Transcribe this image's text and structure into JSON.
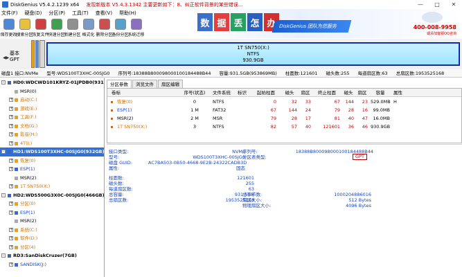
{
  "titlebar": {
    "title": "DiskGenius V5.4.2.1239 x64",
    "notice": "发现新版本 V5.4.3.1342  主要更新如下：8、纠正软件背景的某些错误..."
  },
  "menu": [
    "文件(F)",
    "硬盘(D)",
    "分区(P)",
    "工具(T)",
    "查看(V)",
    "帮助(H)"
  ],
  "toolbar": [
    "保存更改",
    "搜索分区",
    "恢复文件",
    "快速分区",
    "新建分区",
    "格式化",
    "删除分区",
    "备份分区",
    "系统迁移"
  ],
  "banner": {
    "tiles": [
      "数",
      "据",
      "丢",
      "怎",
      "办"
    ],
    "brand": "DiskGenius 团队为您服务",
    "phone": "400-008-9958",
    "qq": "或添加客服QQ咨询"
  },
  "diskmap": {
    "basic_line1": "基本",
    "basic_line2": "GPT",
    "seg_name": "1T SN750(X:)",
    "seg_fs": "NTFS",
    "seg_size": "930.9GB"
  },
  "diskinfo": {
    "iface": "磁盘1 接口:NVMe",
    "model": "型号:WDS100T3XHC-00SJG0",
    "serial": "序列号:18388B800098000100184488B44",
    "capacity": "容量:931.5GB(953869MB)",
    "cyl": "柱面数:121601",
    "heads": "磁头数:255",
    "spt": "每道扇区数:63",
    "total": "总扇区数:1953525168"
  },
  "tree": [
    {
      "level": 0,
      "toggle": "-",
      "text": "HD0:WDCWD101KRYZ-01JPDB0(931.5GB)",
      "color": ""
    },
    {
      "level": 1,
      "toggle": "",
      "text": "MSR(0)",
      "color": ""
    },
    {
      "level": 1,
      "toggle": "+",
      "text": "启动(C:)",
      "color": "orange"
    },
    {
      "level": 1,
      "toggle": "+",
      "text": "游戏(E:)",
      "color": "orange"
    },
    {
      "level": 1,
      "toggle": "+",
      "text": "工具(F:)",
      "color": "orange"
    },
    {
      "level": 1,
      "toggle": "+",
      "text": "文档(G:)",
      "color": "orange"
    },
    {
      "level": 1,
      "toggle": "+",
      "text": "影音(H:)",
      "color": "orange"
    },
    {
      "level": 1,
      "toggle": "+",
      "text": "4T(I:)",
      "color": "orange"
    },
    {
      "level": 0,
      "toggle": "-",
      "text": "HD1:WDS100T3XHC-00SJG0(932GB)",
      "color": "",
      "selected": true
    },
    {
      "level": 1,
      "toggle": "+",
      "text": "恢复(0)",
      "color": "orange"
    },
    {
      "level": 1,
      "toggle": "+",
      "text": "ESP(1)",
      "color": "blue"
    },
    {
      "level": 1,
      "toggle": "",
      "text": "MSR(2)",
      "color": ""
    },
    {
      "level": 1,
      "toggle": "+",
      "text": "1T SN750(X:)",
      "color": "orange"
    },
    {
      "level": 0,
      "toggle": "-",
      "text": "HD2:WDS500G3X0C-00SJG0(466GB)",
      "color": ""
    },
    {
      "level": 1,
      "toggle": "+",
      "text": "分区(0)",
      "color": "orange"
    },
    {
      "level": 1,
      "toggle": "+",
      "text": "ESP(1)",
      "color": "blue"
    },
    {
      "level": 1,
      "toggle": "",
      "text": "MSR(2)",
      "color": ""
    },
    {
      "level": 1,
      "toggle": "+",
      "text": "系统(C:)",
      "color": "orange"
    },
    {
      "level": 1,
      "toggle": "+",
      "text": "软件(D:)",
      "color": "orange"
    },
    {
      "level": 1,
      "toggle": "+",
      "text": "分区(4)",
      "color": "orange"
    },
    {
      "level": 0,
      "toggle": "-",
      "text": "RD3:SanDiskCruzer(7GB)",
      "color": ""
    },
    {
      "level": 1,
      "toggle": "+",
      "text": "SANDISK(J:)",
      "color": "blue"
    }
  ],
  "tabs": [
    "分区参数",
    "浏览文件",
    "扇区编辑"
  ],
  "ptable": {
    "headers": [
      "卷标",
      "序号(状态)",
      "文件系统",
      "标识",
      "起始柱面",
      "磁头",
      "扇区",
      "终止柱面",
      "磁头",
      "扇区",
      "容量",
      "属性"
    ],
    "rows": [
      [
        "恢复(0)",
        "0",
        "NTFS",
        "",
        "0",
        "32",
        "33",
        "67",
        "144",
        "23",
        "529.0MB",
        "H"
      ],
      [
        "ESP(1)",
        "1 M",
        "FAT32",
        "",
        "67",
        "144",
        "24",
        "79",
        "28",
        "16",
        "99.0MB",
        ""
      ],
      [
        "MSR(2)",
        "2 M",
        "MSR",
        "",
        "79",
        "28",
        "17",
        "81",
        "40",
        "47",
        "16.0MB",
        ""
      ],
      [
        "1T SN750(X:)",
        "3",
        "NTFS",
        "",
        "82",
        "57",
        "40",
        "121601",
        "36",
        "46",
        "930.9GB",
        ""
      ]
    ],
    "row_colors": [
      "orange",
      "blue",
      "",
      "orange"
    ]
  },
  "details": {
    "left": [
      {
        "label": "接口类型:",
        "value": "NVMe"
      },
      {
        "label": "型号:",
        "value": "WDS100T3XHC-00SJG0"
      },
      {
        "label": "磁盘 GUID:",
        "value": "AC7BA503-0B50-4668-9E2B-24322CADB3D"
      },
      {
        "label": "属性:",
        "value": "固态"
      }
    ],
    "right": [
      {
        "label": "序列号:",
        "value": "18388B800098000100184488B44"
      },
      {
        "label": "分区表类型:",
        "value": "GPT"
      }
    ],
    "geo_left": [
      {
        "label": "柱面数:",
        "value": "121601"
      },
      {
        "label": "磁头数:",
        "value": "255"
      },
      {
        "label": "每道扇区数:",
        "value": "63"
      },
      {
        "label": "总容量:",
        "value": "931.5GB"
      },
      {
        "label": "总扇区数:",
        "value": "1953525168"
      }
    ],
    "geo_right": [
      {
        "label": "总字节数:",
        "value": "1000204886016"
      },
      {
        "label": "扇区大小:",
        "value": "512 Bytes"
      },
      {
        "label": "物理扇区大小:",
        "value": "4096 Bytes"
      }
    ]
  }
}
